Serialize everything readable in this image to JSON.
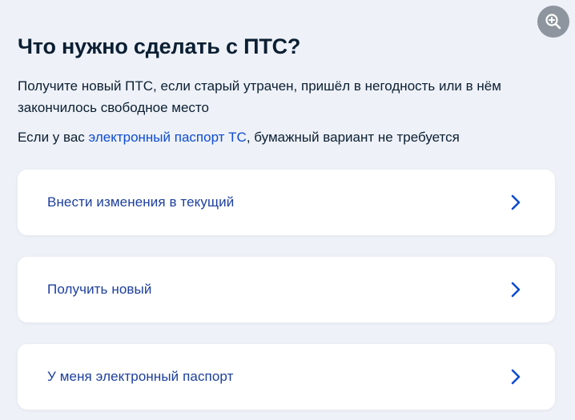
{
  "header": {
    "title": "Что нужно сделать с ПТС?"
  },
  "intro": {
    "description": "Получите новый ПТС, если старый утрачен, пришёл в негодность или в нём закончилось свободное место",
    "epts_prefix": "Если у вас ",
    "epts_link": "электронный паспорт ТС",
    "epts_suffix": ", бумажный вариант не требуется"
  },
  "options": [
    {
      "label": "Внести изменения в текущий",
      "icon": "chevron-right-icon"
    },
    {
      "label": "Получить новый",
      "icon": "chevron-right-icon"
    },
    {
      "label": "У меня электронный паспорт",
      "icon": "chevron-right-icon"
    }
  ],
  "toolbar": {
    "zoom_icon": "zoom-in-icon"
  },
  "colors": {
    "background": "#eef1f7",
    "card": "#ffffff",
    "link": "#0d4cd3",
    "option_text": "#1c3f9e",
    "text": "#0b1f33",
    "zoom_button": "#8e959e"
  }
}
